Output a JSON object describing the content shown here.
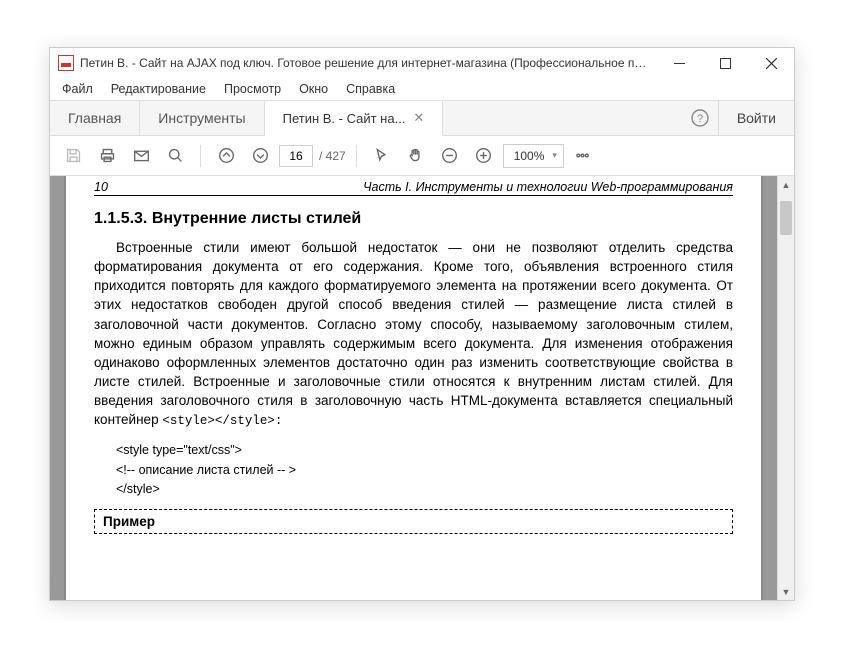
{
  "window": {
    "title": "Петин В. - Сайт на AJAX под ключ. Готовое решение для интернет-магазина (Профессиональное про..."
  },
  "menu": {
    "file": "Файл",
    "edit": "Редактирование",
    "view": "Просмотр",
    "window": "Окно",
    "help": "Справка"
  },
  "tabs": {
    "home": "Главная",
    "tools": "Инструменты",
    "doc": "Петин В. - Сайт на..."
  },
  "login": "Войти",
  "toolbar": {
    "page_current": "16",
    "page_total": "/  427",
    "zoom": "100%"
  },
  "doc": {
    "page_num": "10",
    "running_head": "Часть I. Инструменты и технологии Web-программирования",
    "heading": "1.1.5.3. Внутренние листы стилей",
    "para": "Встроенные стили имеют большой недостаток — они не позволяют отделить средства форматирования документа от его содержания. Кроме того, объявления встроенного стиля приходится повторять для каждого форматируемого элемента на протяжении всего документа. От этих недостатков свободен другой способ введения стилей — размещение листа стилей в заголовочной части документов. Согласно этому способу, называемому заголовочным стилем, можно единым образом управлять содержимым всего документа. Для изменения отображения одинаково оформленных элементов достаточно один раз изменить соответствующие свойства в листе стилей. Встроенные и заголовочные стили относятся к внутренним листам стилей. Для введения заголовочного стиля в заголовочную часть HTML-документа вставляется специальный контейнер ",
    "inline_code": "<style></style>:",
    "code1": "<style type=\"text/css\">",
    "code2": "<!--  описание листа стилей  -- >",
    "code3": "</style>",
    "example_label": "Пример"
  }
}
